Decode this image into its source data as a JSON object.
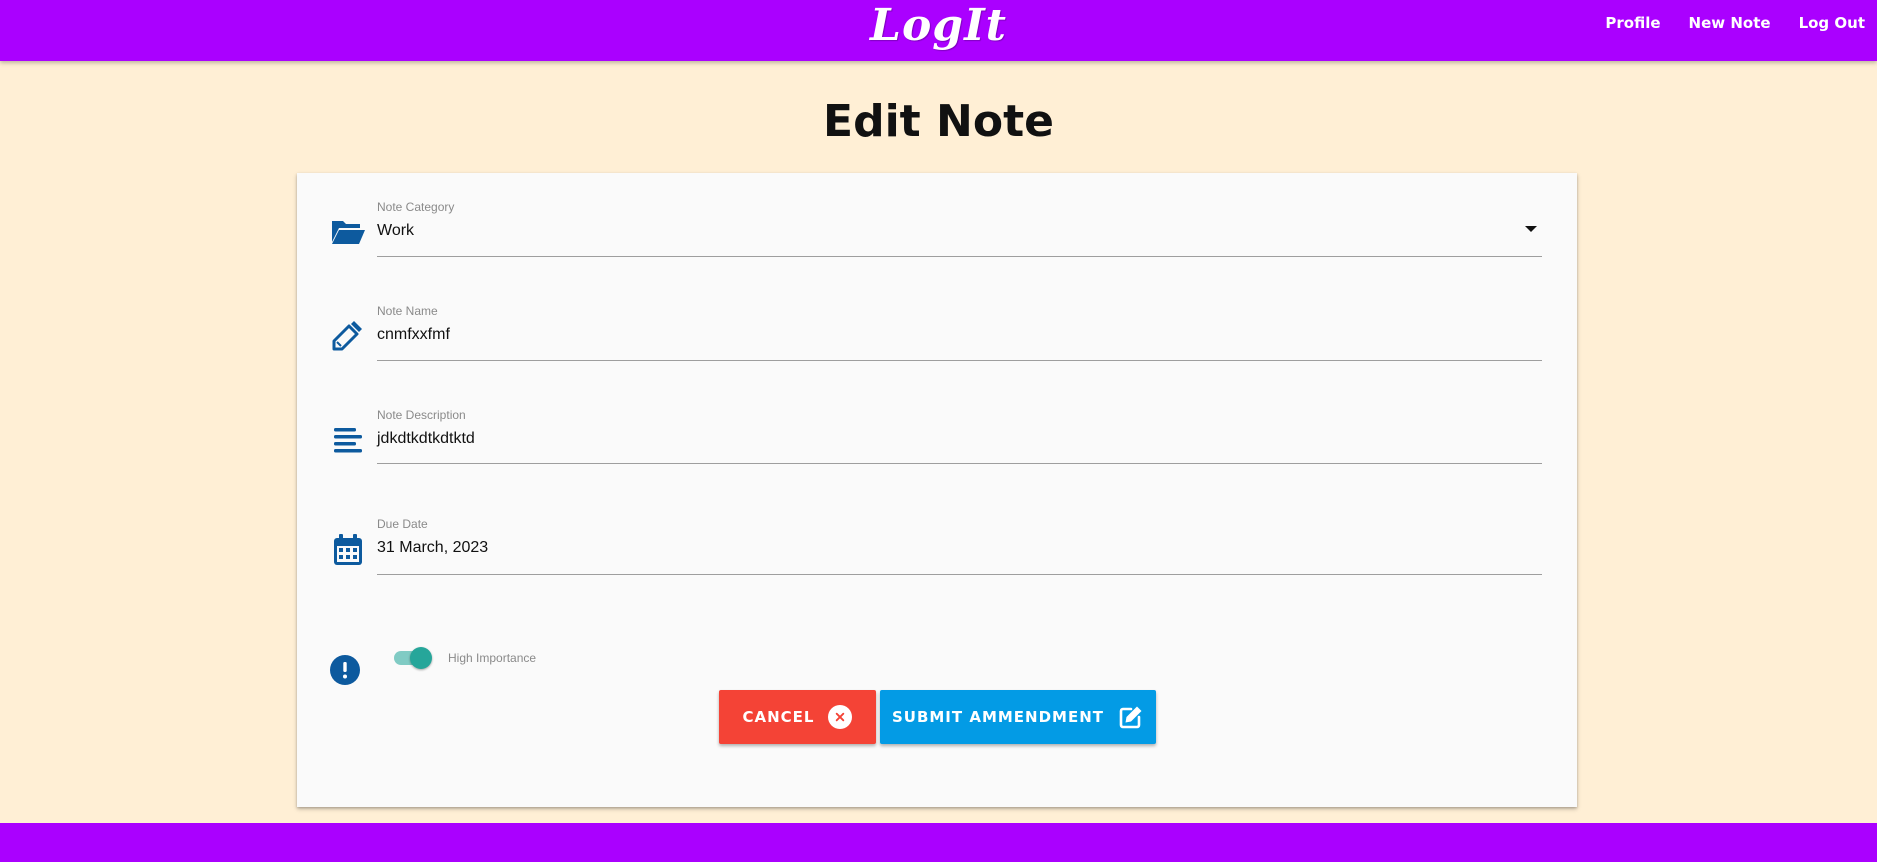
{
  "header": {
    "logo": "LogIt",
    "nav": [
      "Profile",
      "New Note",
      "Log Out"
    ]
  },
  "page_title": "Edit Note",
  "form": {
    "category": {
      "label": "Note Category",
      "value": "Work",
      "icon": "folder-open-icon"
    },
    "name": {
      "label": "Note Name",
      "value": "cnmfxxfmf",
      "icon": "pencil-icon"
    },
    "description": {
      "label": "Note Description",
      "value": "jdkdtkdtkdtktd",
      "icon": "align-left-icon"
    },
    "due_date": {
      "label": "Due Date",
      "value": "31 March, 2023",
      "icon": "calendar-icon"
    },
    "importance": {
      "label": "High Importance",
      "checked": true,
      "icon": "exclamation-circle-icon"
    }
  },
  "buttons": {
    "cancel": "CANCEL",
    "submit": "SUBMIT AMMENDMENT"
  },
  "colors": {
    "brand": "#aa00ff",
    "background": "#ffefd5",
    "icon": "#0d5a9e",
    "cancel": "#f44336",
    "submit": "#039be5",
    "toggle": "#26a69a"
  }
}
